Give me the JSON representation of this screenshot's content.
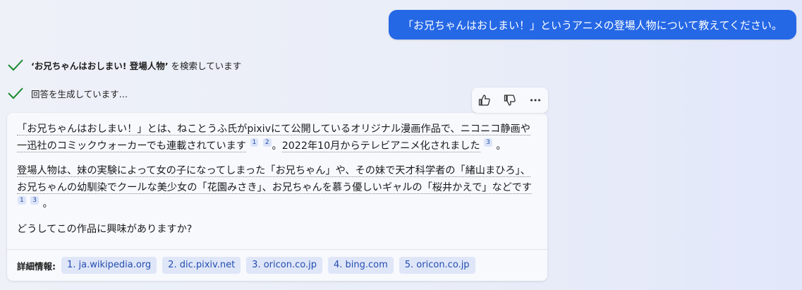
{
  "user_message": "「お兄ちゃんはおしまい！」というアニメの登場人物について教えてください。",
  "progress": [
    {
      "quote_open": "‘",
      "query": "お兄ちゃんはおしまい! 登場人物",
      "quote_close": "’",
      "suffix": " を検索しています"
    },
    {
      "text": "回答を生成しています…"
    }
  ],
  "response": {
    "p1": {
      "a": "「お兄ちゃんはおしまい！」とは、ねことうふ氏がpixivにて公開しているオリジナル漫画作品で、ニコニコ静画や一迅社のコミックウォーカーでも連載されています",
      "cites_a": [
        "1",
        "2"
      ],
      "sep": "。",
      "b": "2022年10月からテレビアニメ化されました",
      "cites_b": [
        "3"
      ],
      "end": "。"
    },
    "p2": {
      "a": "登場人物は、妹の実験によって女の子になってしまった「お兄ちゃん」や、その妹で天才科学者の「緒山まひろ」、お兄ちゃんの幼馴染でクールな美少女の「花園みさき」、お兄ちゃんを慕う優しいギャルの「桜井かえで」などです",
      "cites": [
        "1",
        "3"
      ],
      "end": "。"
    },
    "p3": "どうしてこの作品に興味がありますか?"
  },
  "more_info": {
    "label": "詳細情報:",
    "links": [
      "1. ja.wikipedia.org",
      "2. dic.pixiv.net",
      "3. oricon.co.jp",
      "4. bing.com",
      "5. oricon.co.jp"
    ]
  },
  "icons": {
    "check": "check-icon",
    "thumbs_up": "thumbs-up-icon",
    "thumbs_down": "thumbs-down-icon",
    "more": "more-icon"
  },
  "colors": {
    "user_bubble": "#2568e6",
    "check": "#1a8a2e",
    "chip_bg": "#dfe6f8",
    "chip_text": "#244db0"
  }
}
